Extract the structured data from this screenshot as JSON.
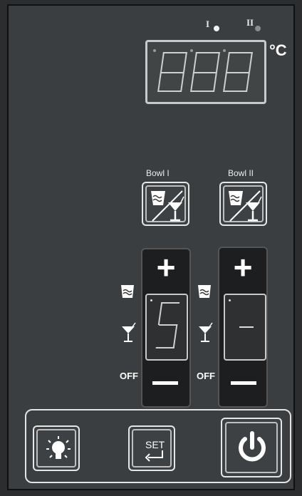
{
  "indicators": {
    "one_label": "I",
    "two_label": "II"
  },
  "temperature": {
    "display": "888",
    "unit": "°C"
  },
  "bowls": [
    {
      "label": "Bowl I"
    },
    {
      "label": "Bowl II"
    }
  ],
  "zones": [
    {
      "display_value": "5",
      "off_label": "OFF"
    },
    {
      "display_value": "-",
      "off_label": "OFF"
    }
  ],
  "buttons": {
    "set_label": "SET"
  },
  "icons": {
    "bowl_ice": "bowl-ice-icon",
    "cocktail": "cocktail-glass-icon",
    "light": "light-bulb-icon",
    "enter": "enter-arrow-icon",
    "power": "power-icon"
  }
}
